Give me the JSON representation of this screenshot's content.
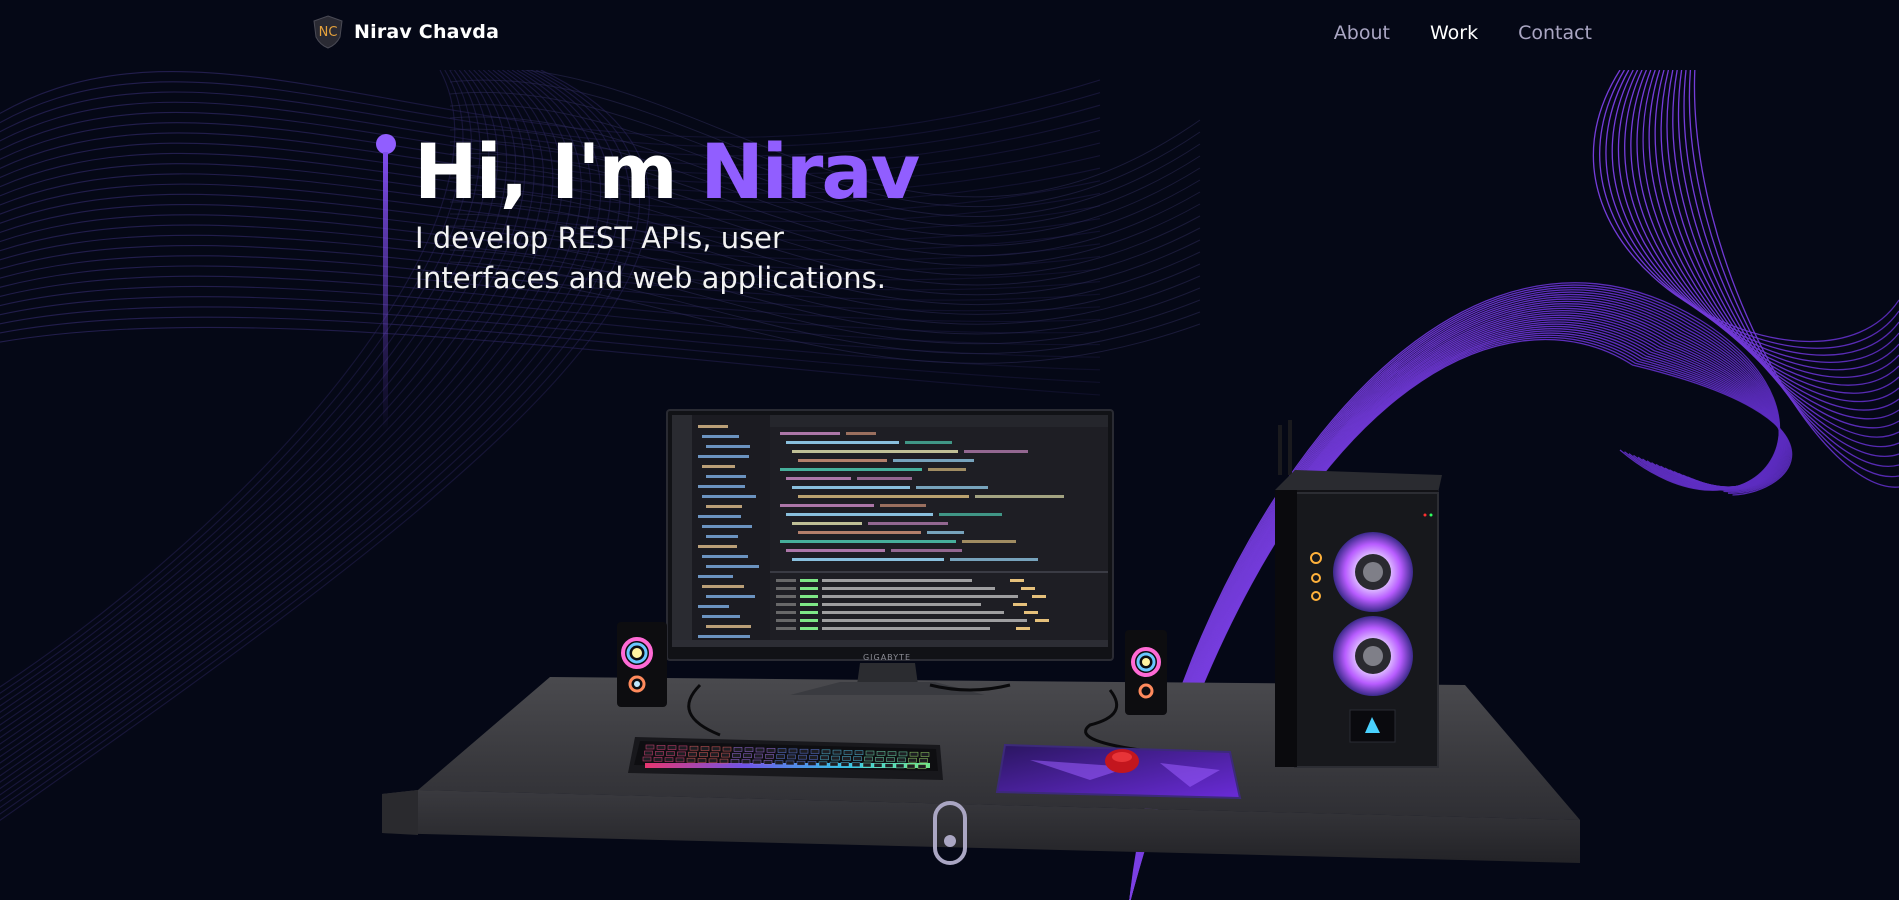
{
  "navbar": {
    "logo_text": "NC",
    "brand_name": "Nirav  Chavda",
    "links": [
      {
        "label": "About",
        "active": false
      },
      {
        "label": "Work",
        "active": true
      },
      {
        "label": "Contact",
        "active": false
      }
    ]
  },
  "hero": {
    "title_prefix": "Hi, I'm ",
    "title_name": "Nirav",
    "subtitle_line1": "I develop REST APIs, user",
    "subtitle_line2": "interfaces and web applications."
  },
  "monitor": {
    "brand": "GIGABYTE"
  },
  "colors": {
    "background": "#050816",
    "accent": "#915eff",
    "nav_text": "#aaa6c3",
    "white": "#ffffff"
  },
  "icons": {
    "logo": "nc-shield-logo",
    "scroll": "mouse-scroll-icon"
  }
}
